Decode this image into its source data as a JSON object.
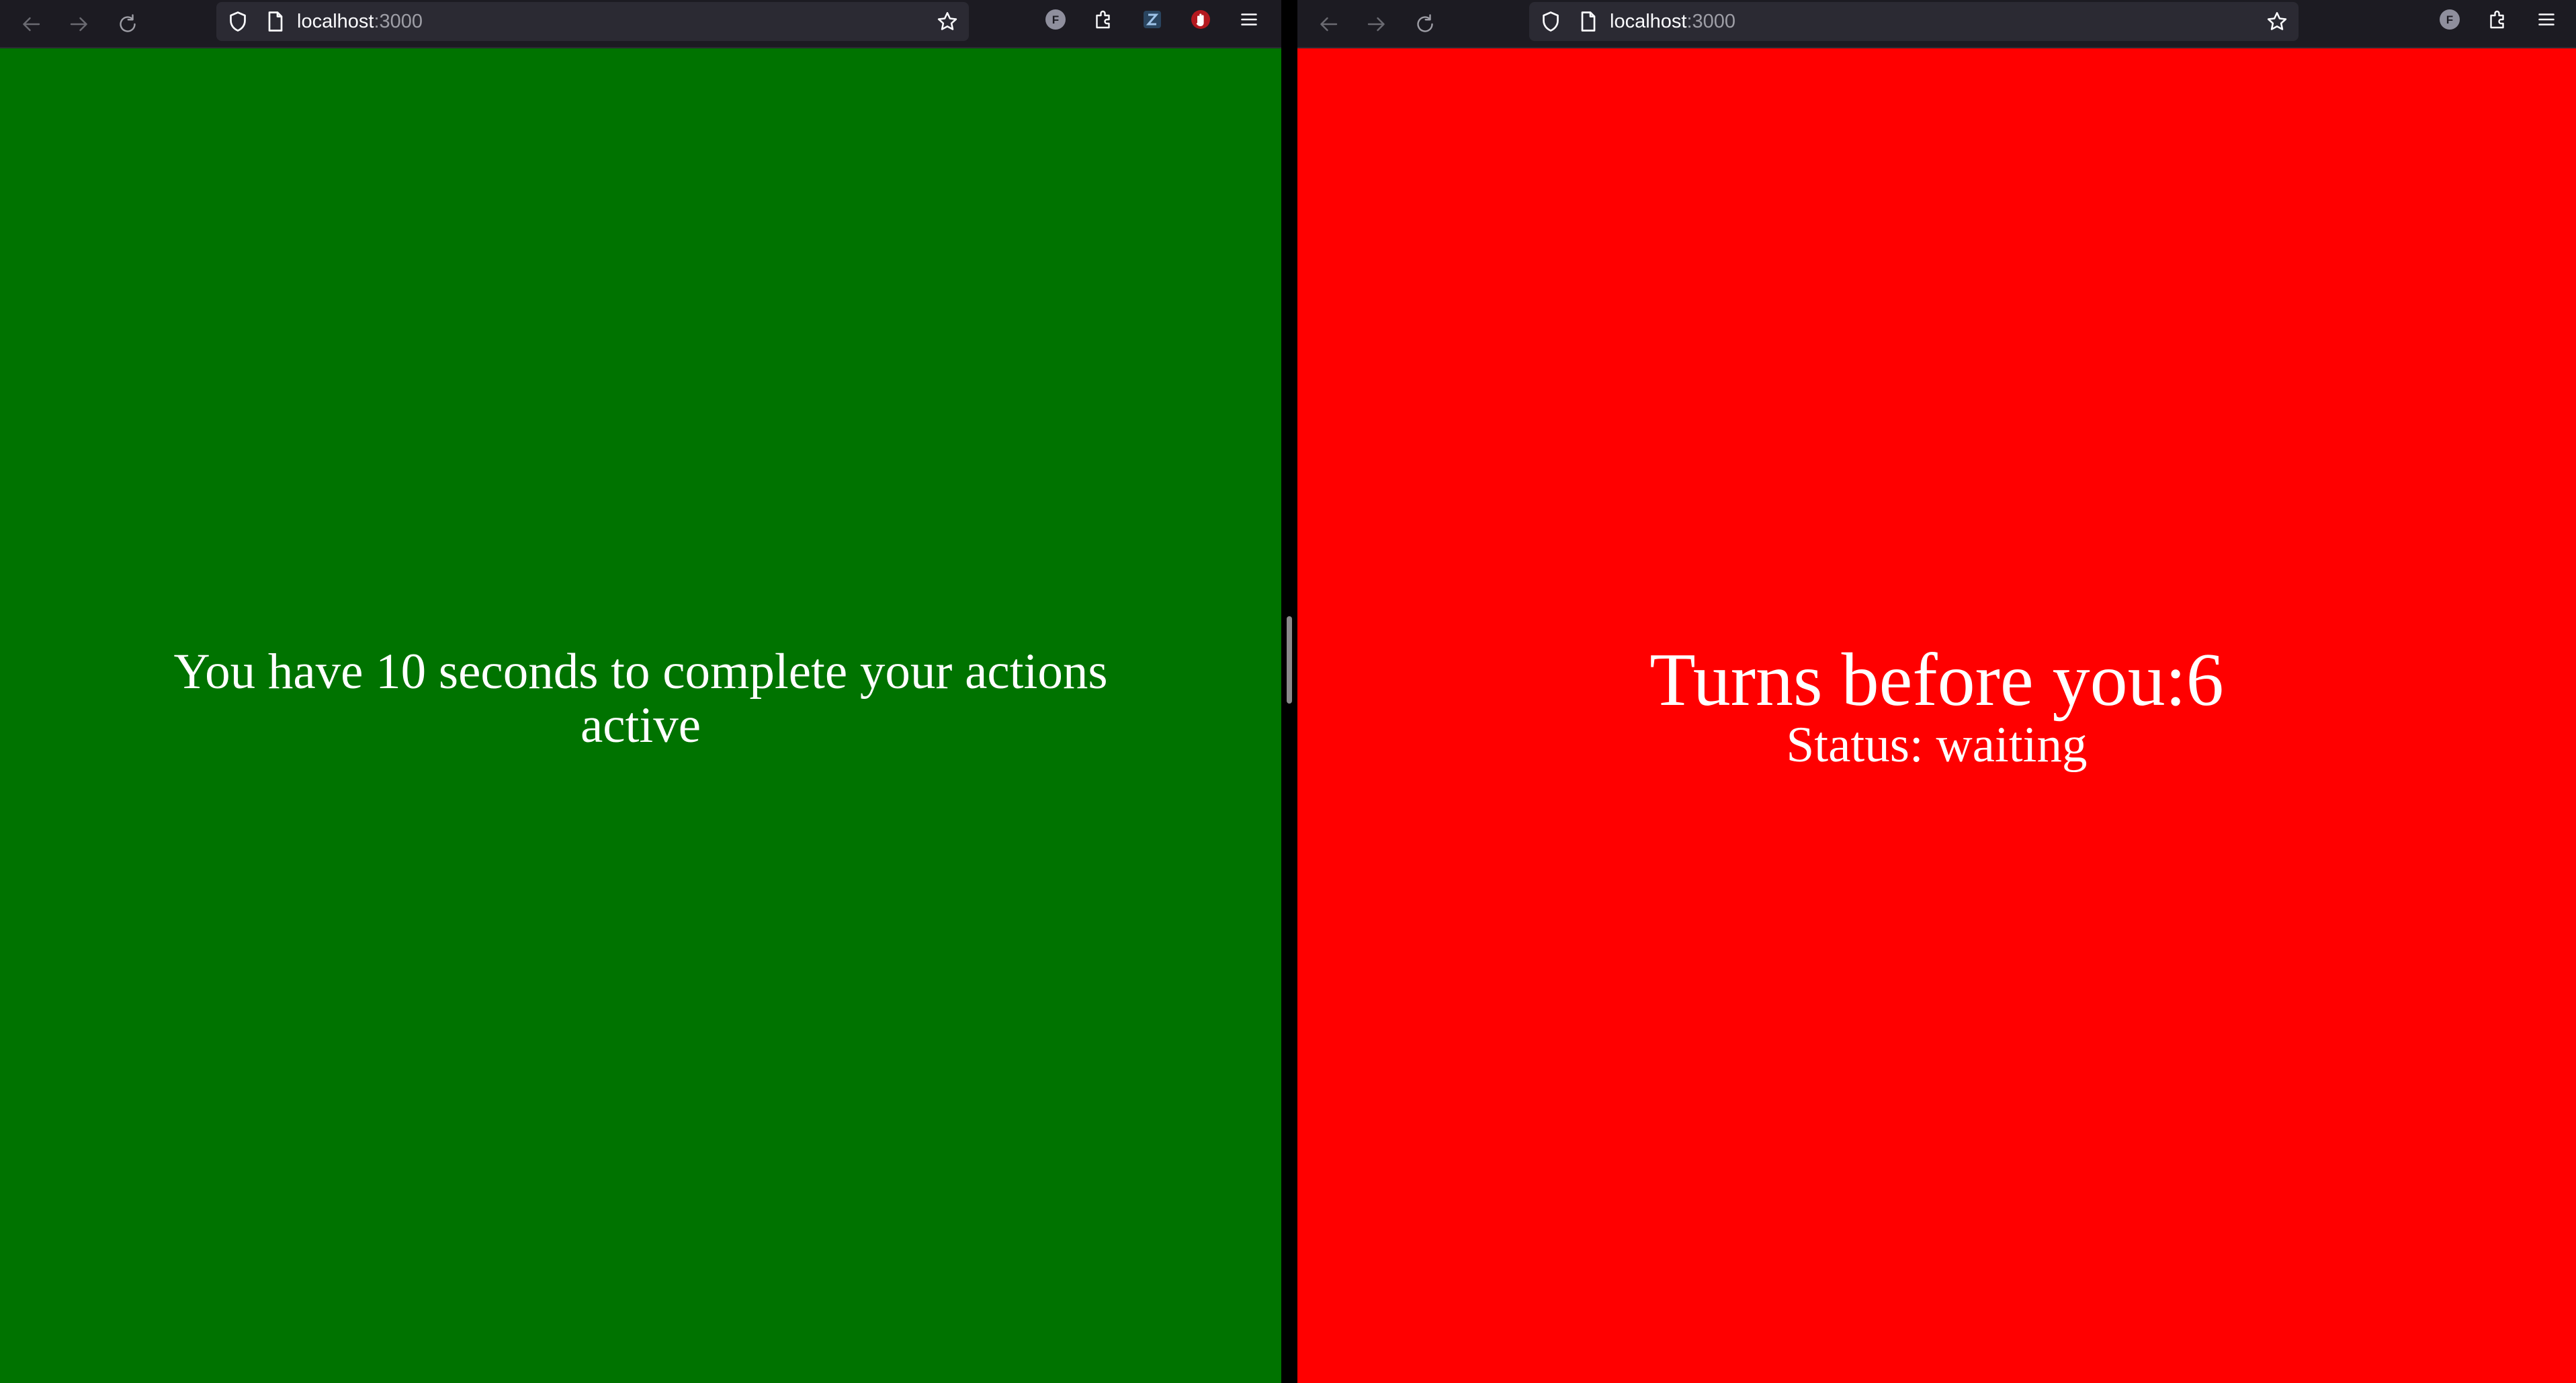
{
  "windows": {
    "left": {
      "url_host": "localhost",
      "url_port": ":3000",
      "background_color": "#007300",
      "message": "You have 10 seconds to complete your actions",
      "state": "active"
    },
    "right": {
      "url_host": "localhost",
      "url_port": ":3000",
      "background_color": "#ff0000",
      "turns_label": "Turns before you:6",
      "status_label": "Status: waiting"
    }
  },
  "toolbar": {
    "icons": [
      "back-arrow-icon",
      "forward-arrow-icon",
      "reload-icon",
      "shield-icon",
      "page-icon",
      "star-icon",
      "account-icon",
      "extensions-icon",
      "app-menu-icon"
    ],
    "account_initial": "F",
    "extra_extensions_left": [
      "zotero-extension-icon",
      "ublock-extension-icon"
    ]
  },
  "colors": {
    "toolbar_bg": "#1c1b22",
    "urlbar_bg": "#2b2a33",
    "icon": "#fbfbfe",
    "text": "#ffffff"
  }
}
